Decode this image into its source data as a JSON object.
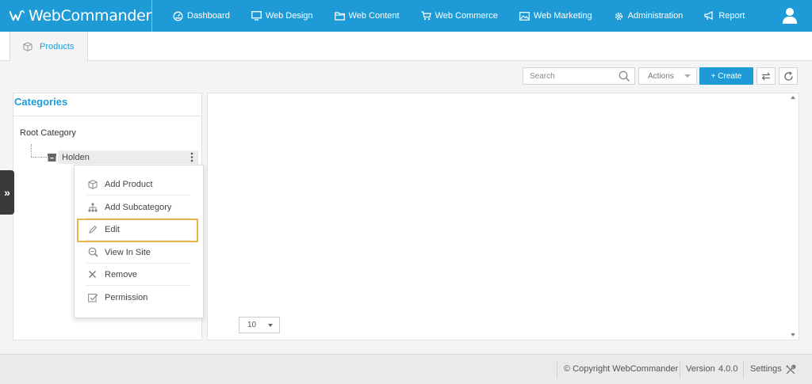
{
  "app": {
    "name": "WebCommander"
  },
  "nav": {
    "items": [
      {
        "label": "Dashboard",
        "icon": "dashboard-icon"
      },
      {
        "label": "Web Design",
        "icon": "monitor-icon"
      },
      {
        "label": "Web Content",
        "icon": "folder-icon"
      },
      {
        "label": "Web Commerce",
        "icon": "cart-icon"
      },
      {
        "label": "Web Marketing",
        "icon": "image-icon"
      },
      {
        "label": "Administration",
        "icon": "gear-icon"
      },
      {
        "label": "Report",
        "icon": "megaphone-icon"
      }
    ]
  },
  "tab": {
    "label": "Products",
    "icon": "box-icon"
  },
  "toolbar": {
    "search_placeholder": "Search",
    "actions_label": "Actions",
    "create_label": "+ Create"
  },
  "categories": {
    "title": "Categories",
    "root_label": "Root Category",
    "items": [
      {
        "label": "Holden"
      }
    ]
  },
  "context_menu": {
    "items": [
      {
        "label": "Add Product",
        "icon": "box-icon"
      },
      {
        "label": "Add Subcategory",
        "icon": "hierarchy-icon"
      },
      {
        "label": "Edit",
        "icon": "pencil-icon"
      },
      {
        "label": "View In Site",
        "icon": "magnify-icon"
      },
      {
        "label": "Remove",
        "icon": "close-icon"
      },
      {
        "label": "Permission",
        "icon": "checkbox-icon"
      }
    ],
    "highlighted": "Edit"
  },
  "pagination": {
    "page_size": "10"
  },
  "footer": {
    "copyright": "© Copyright WebCommander",
    "version_label": "Version",
    "version": "4.0.0",
    "settings_label": "Settings"
  },
  "colors": {
    "brand": "#1e9bd7",
    "highlight": "#e8b54a"
  }
}
